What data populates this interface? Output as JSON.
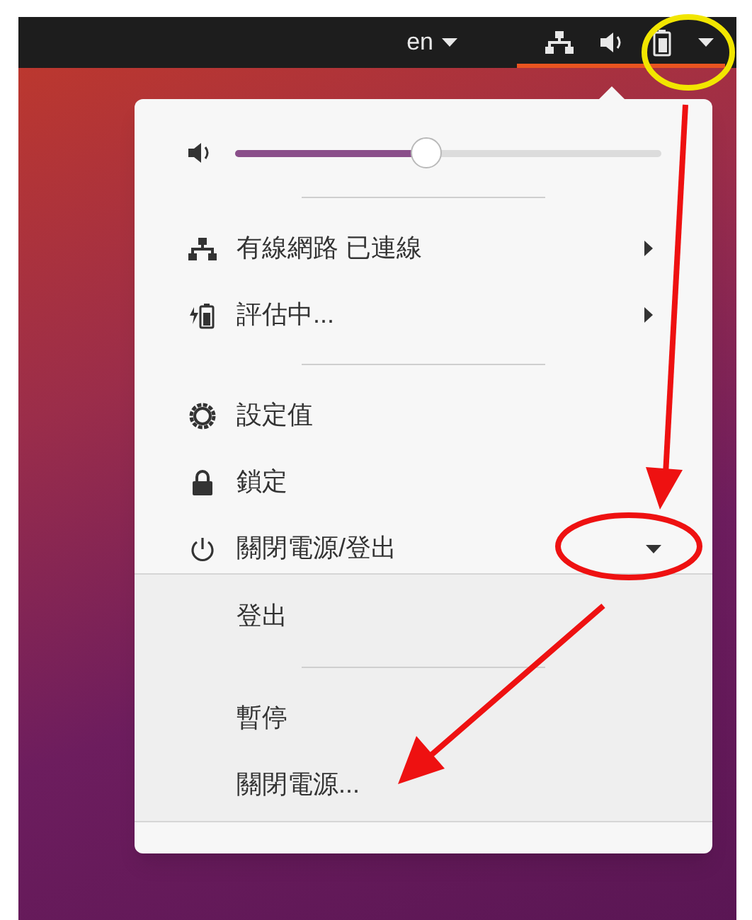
{
  "top_bar": {
    "language": "en",
    "tray_active": true
  },
  "menu": {
    "volume": {
      "level": 0.45
    },
    "sections": [
      [
        {
          "kind": "submenu",
          "label": "有線網路 已連線"
        },
        {
          "kind": "submenu",
          "label": "評估中..."
        }
      ],
      [
        {
          "kind": "plain",
          "label": "設定值"
        },
        {
          "kind": "plain",
          "label": "鎖定"
        },
        {
          "kind": "expander",
          "label": "關閉電源/登出",
          "expanded": true,
          "children": [
            [
              {
                "label": "登出"
              }
            ],
            [
              {
                "label": "暫停"
              },
              {
                "label": "關閉電源..."
              }
            ]
          ]
        }
      ]
    ]
  }
}
